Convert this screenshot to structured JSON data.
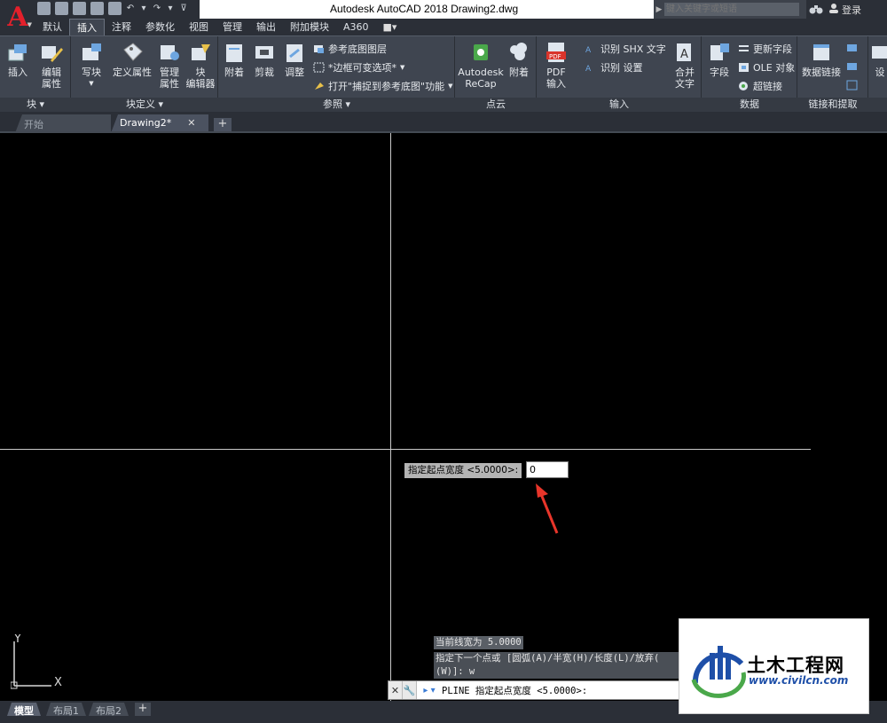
{
  "titlebar": {
    "title": "Autodesk AutoCAD 2018    Drawing2.dwg",
    "search_placeholder": "键入关键字或短语",
    "login": "登录"
  },
  "ribbon_tabs": [
    "默认",
    "插入",
    "注释",
    "参数化",
    "视图",
    "管理",
    "输出",
    "附加模块",
    "A360"
  ],
  "active_ribbon_tab": "插入",
  "panels": {
    "block": {
      "title": "块",
      "insert": "插入",
      "edit_attr_1": "编辑",
      "edit_attr_2": "属性"
    },
    "block_def": {
      "title": "块定义",
      "write_block": "写块",
      "define_attr": "定义属性",
      "manage_attr_1": "管理",
      "manage_attr_2": "属性",
      "block_editor_1": "块",
      "block_editor_2": "编辑器"
    },
    "reference": {
      "title": "参照",
      "attach": "附着",
      "clip": "剪裁",
      "adjust": "调整",
      "underlay_layers": "参考底图图层",
      "frame_variable": "*边框可变选项*",
      "snap_underlay": "打开\"捕捉到参考底图\"功能"
    },
    "point_cloud": {
      "title": "点云",
      "recap_1": "Autodesk",
      "recap_2": "ReCap",
      "attach": "附着"
    },
    "import": {
      "title": "输入",
      "pdf_1": "PDF",
      "pdf_2": "输入",
      "recognize_shx": "识别 SHX 文字",
      "recognize_settings": "识别 设置",
      "combine_1": "合并",
      "combine_2": "文字"
    },
    "data": {
      "title": "数据",
      "field": "字段",
      "update_field": "更新字段",
      "ole": "OLE 对象",
      "hyperlink": "超链接"
    },
    "link_extract": {
      "title": "链接和提取",
      "data_link": "数据链接"
    },
    "last": {
      "label": "设"
    }
  },
  "doc_tabs": {
    "start": "开始",
    "drawing": "Drawing2*"
  },
  "canvas": {
    "dyn_label": "指定起点宽度 <5.0000>:",
    "dyn_value": "0",
    "ucs_y": "Y",
    "ucs_x": "X",
    "history_1": "当前线宽为 5.0000",
    "history_2": "指定下一个点或 [圆弧(A)/半宽(H)/长度(L)/放弃(",
    "history_3": "(W)]: w"
  },
  "command_line": {
    "text": "PLINE 指定起点宽度 <5.0000>:"
  },
  "layout_tabs": [
    "模型",
    "布局1",
    "布局2"
  ],
  "watermark": {
    "name": "土木工程网",
    "url": "www.civilcn.com"
  },
  "colors": {
    "logo_red": "#e4202b",
    "arrow_red": "#e8352a",
    "wm_blue": "#1e4fa8",
    "wm_green": "#4aa84a"
  }
}
